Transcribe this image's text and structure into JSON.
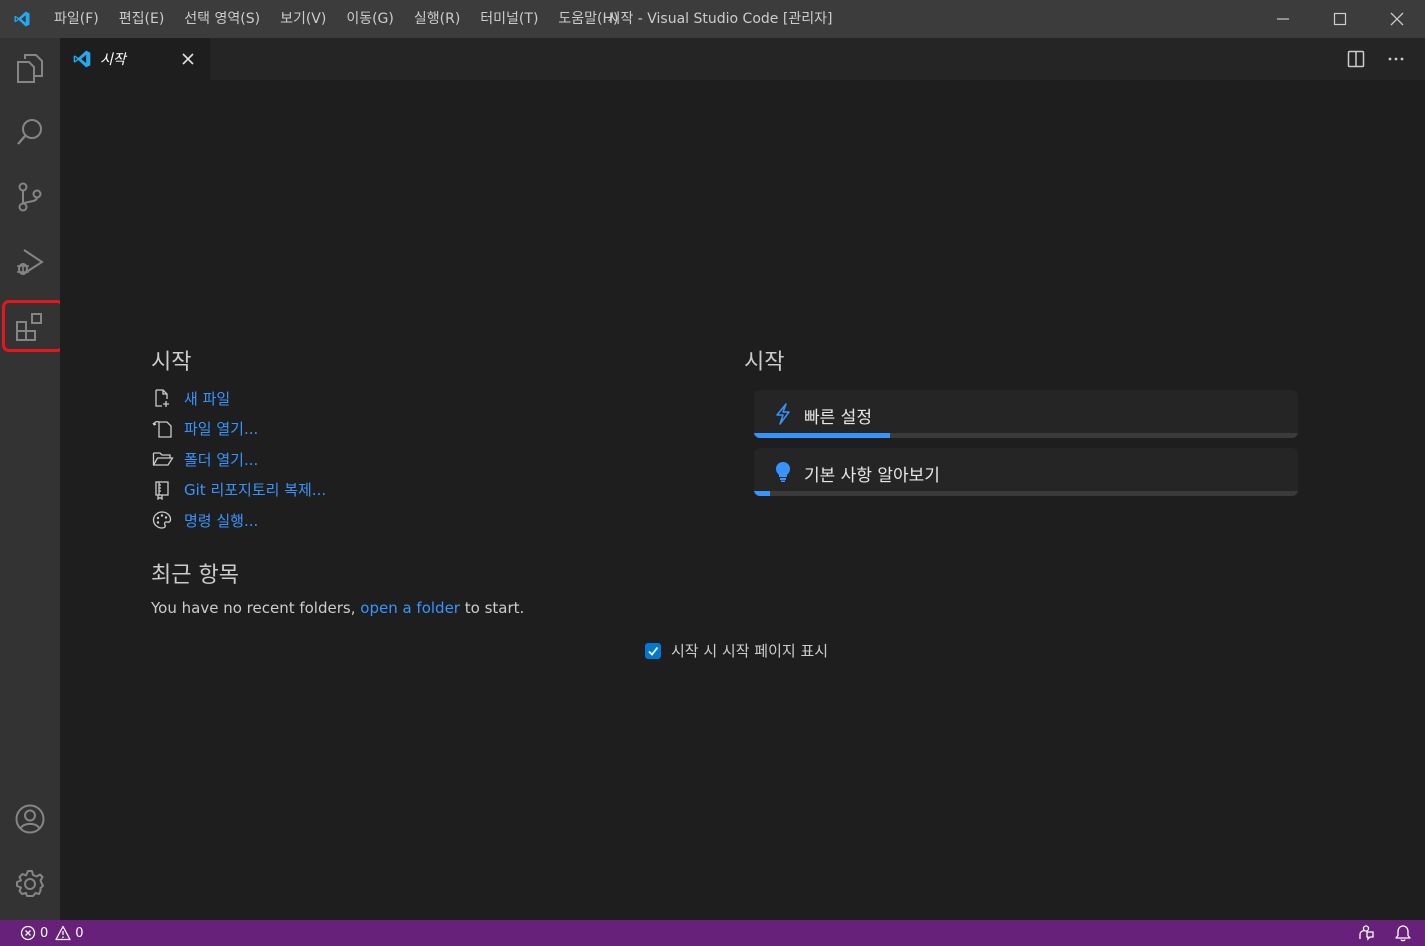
{
  "titlebar": {
    "window_title": "시작 - Visual Studio Code [관리자]",
    "menu": [
      "파일(F)",
      "편집(E)",
      "선택 영역(S)",
      "보기(V)",
      "이동(G)",
      "실행(R)",
      "터미널(T)",
      "도움말(H)"
    ]
  },
  "activitybar": {
    "items": [
      "explorer-icon",
      "search-icon",
      "source-control-icon",
      "run-debug-icon",
      "extensions-icon"
    ],
    "bottom": [
      "account-icon",
      "settings-gear-icon"
    ],
    "highlighted": "extensions-icon"
  },
  "tabs": [
    {
      "label": "시작",
      "active": true
    }
  ],
  "start": {
    "title": "시작",
    "links": [
      {
        "icon": "new-file-icon",
        "label": "새 파일"
      },
      {
        "icon": "open-file-icon",
        "label": "파일 열기..."
      },
      {
        "icon": "open-folder-icon",
        "label": "폴더 열기..."
      },
      {
        "icon": "git-clone-icon",
        "label": "Git 리포지토리 복제..."
      },
      {
        "icon": "command-palette-icon",
        "label": "명령 실행..."
      }
    ]
  },
  "recent": {
    "title": "최근 항목",
    "text_before": "You have no recent folders,",
    "link": "open a folder",
    "text_after": "to start."
  },
  "walkthroughs": {
    "title": "시작",
    "items": [
      {
        "icon": "lightning-icon",
        "label": "빠른 설정",
        "progress": 0.25
      },
      {
        "icon": "lightbulb-icon",
        "label": "기본 사항 알아보기",
        "progress": 0.03
      }
    ]
  },
  "startup_checkbox": {
    "label": "시작 시 시작 페이지 표시",
    "checked": true
  },
  "statusbar": {
    "errors": "0",
    "warnings": "0"
  },
  "colors": {
    "accent": "#3794ff",
    "statusbar": "#68217a",
    "highlight": "#e8151b"
  }
}
